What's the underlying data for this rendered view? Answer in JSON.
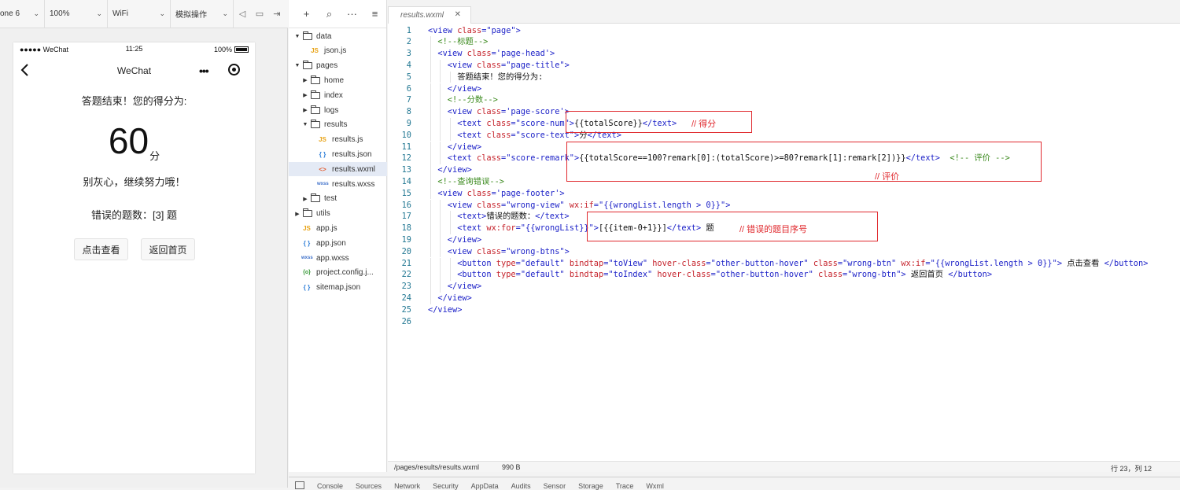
{
  "simulator": {
    "toolbar": {
      "device": "one 6",
      "zoom": "100%",
      "network": "WiFi",
      "mode": "模拟操作"
    },
    "status_bar": {
      "carrier": "●●●●● WeChat",
      "time": "11:25",
      "battery": "100%"
    },
    "nav": {
      "title": "WeChat"
    },
    "page": {
      "title": "答题结束！您的得分为:",
      "score": "60",
      "score_unit": "分",
      "remark": "别灰心，继续努力哦！",
      "wrong_count": "错误的题数：[3] 题",
      "btn_view": "点击查看",
      "btn_home": "返回首页"
    }
  },
  "file_tree": [
    {
      "name": "data",
      "kind": "folder",
      "state": "open",
      "depth": 0
    },
    {
      "name": "json.js",
      "kind": "js",
      "depth": 1
    },
    {
      "name": "pages",
      "kind": "folder",
      "state": "open",
      "depth": 0
    },
    {
      "name": "home",
      "kind": "folder",
      "state": "closed",
      "depth": 1
    },
    {
      "name": "index",
      "kind": "folder",
      "state": "closed",
      "depth": 1
    },
    {
      "name": "logs",
      "kind": "folder",
      "state": "closed",
      "depth": 1
    },
    {
      "name": "results",
      "kind": "folder",
      "state": "open",
      "depth": 1
    },
    {
      "name": "results.js",
      "kind": "js",
      "depth": 2
    },
    {
      "name": "results.json",
      "kind": "json",
      "depth": 2
    },
    {
      "name": "results.wxml",
      "kind": "wxml",
      "depth": 2,
      "selected": true
    },
    {
      "name": "results.wxss",
      "kind": "wxss",
      "depth": 2
    },
    {
      "name": "test",
      "kind": "folder",
      "state": "closed",
      "depth": 1
    },
    {
      "name": "utils",
      "kind": "folder",
      "state": "closed",
      "depth": 0
    },
    {
      "name": "app.js",
      "kind": "js",
      "depth": 0
    },
    {
      "name": "app.json",
      "kind": "json",
      "depth": 0
    },
    {
      "name": "app.wxss",
      "kind": "wxss",
      "depth": 0
    },
    {
      "name": "project.config.j...",
      "kind": "cfg",
      "depth": 0
    },
    {
      "name": "sitemap.json",
      "kind": "json",
      "depth": 0
    }
  ],
  "file_type_glyphs": {
    "js": "JS",
    "json": "{ }",
    "wxml": "<>",
    "wxss": "wxss",
    "cfg": "{o}"
  },
  "editor": {
    "tab": "results.wxml",
    "code": [
      {
        "indent": 0,
        "tokens": [
          [
            "tag",
            "<view "
          ],
          [
            "attr",
            "class"
          ],
          [
            "tag",
            "="
          ],
          [
            "val",
            "\"page\""
          ],
          [
            "tag",
            ">"
          ]
        ]
      },
      {
        "indent": 1,
        "tokens": [
          [
            "cmt",
            "<!--标题-->"
          ]
        ]
      },
      {
        "indent": 1,
        "tokens": [
          [
            "tag",
            "<view "
          ],
          [
            "attr",
            "class"
          ],
          [
            "tag",
            "="
          ],
          [
            "val",
            "'page-head'"
          ],
          [
            "tag",
            ">"
          ]
        ]
      },
      {
        "indent": 2,
        "tokens": [
          [
            "tag",
            "<view "
          ],
          [
            "attr",
            "class"
          ],
          [
            "tag",
            "="
          ],
          [
            "val",
            "\"page-title\""
          ],
          [
            "tag",
            ">"
          ]
        ]
      },
      {
        "indent": 3,
        "tokens": [
          [
            "txt",
            "答题结束！您的得分为:"
          ]
        ]
      },
      {
        "indent": 2,
        "tokens": [
          [
            "tag",
            "</view>"
          ]
        ]
      },
      {
        "indent": 2,
        "tokens": [
          [
            "cmt",
            "<!--分数-->"
          ]
        ]
      },
      {
        "indent": 2,
        "tokens": [
          [
            "tag",
            "<view "
          ],
          [
            "attr",
            "class"
          ],
          [
            "tag",
            "="
          ],
          [
            "val",
            "'page-score'"
          ],
          [
            "tag",
            ">"
          ]
        ]
      },
      {
        "indent": 3,
        "tokens": [
          [
            "tag",
            "<text "
          ],
          [
            "attr",
            "class"
          ],
          [
            "tag",
            "="
          ],
          [
            "val",
            "\"score-num\""
          ],
          [
            "tag",
            ">"
          ],
          [
            "txt",
            "{{totalScore}}"
          ],
          [
            "tag",
            "</text>"
          ]
        ]
      },
      {
        "indent": 3,
        "tokens": [
          [
            "tag",
            "<text "
          ],
          [
            "attr",
            "class"
          ],
          [
            "tag",
            "="
          ],
          [
            "val",
            "\"score-text\""
          ],
          [
            "tag",
            ">"
          ],
          [
            "txt",
            "分"
          ],
          [
            "tag",
            "</text>"
          ]
        ]
      },
      {
        "indent": 2,
        "tokens": [
          [
            "tag",
            "</view>"
          ]
        ]
      },
      {
        "indent": 2,
        "tokens": [
          [
            "tag",
            "<text "
          ],
          [
            "attr",
            "class"
          ],
          [
            "tag",
            "="
          ],
          [
            "val",
            "\"score-remark\""
          ],
          [
            "tag",
            ">"
          ],
          [
            "txt",
            "{{totalScore==100?remark[0]:(totalScore)>=80?remark[1]:remark[2])}}"
          ],
          [
            "tag",
            "</text>"
          ],
          [
            "txt",
            "  "
          ],
          [
            "cmt",
            "<!-- 评价 -->"
          ]
        ]
      },
      {
        "indent": 1,
        "tokens": [
          [
            "tag",
            "</view>"
          ]
        ]
      },
      {
        "indent": 1,
        "tokens": [
          [
            "cmt",
            "<!--查询错误-->"
          ]
        ]
      },
      {
        "indent": 1,
        "tokens": [
          [
            "tag",
            "<view "
          ],
          [
            "attr",
            "class"
          ],
          [
            "tag",
            "="
          ],
          [
            "val",
            "'page-footer'"
          ],
          [
            "tag",
            ">"
          ]
        ]
      },
      {
        "indent": 2,
        "tokens": [
          [
            "tag",
            "<view "
          ],
          [
            "attr",
            "class"
          ],
          [
            "tag",
            "="
          ],
          [
            "val",
            "\"wrong-view\" "
          ],
          [
            "attr",
            "wx:if"
          ],
          [
            "tag",
            "="
          ],
          [
            "val",
            "\"{{wrongList.length > 0}}\""
          ],
          [
            "tag",
            ">"
          ]
        ]
      },
      {
        "indent": 3,
        "tokens": [
          [
            "tag",
            "<text>"
          ],
          [
            "txt",
            "错误的题数："
          ],
          [
            "tag",
            "</text>"
          ]
        ]
      },
      {
        "indent": 3,
        "tokens": [
          [
            "tag",
            "<text "
          ],
          [
            "attr",
            "wx:for"
          ],
          [
            "tag",
            "="
          ],
          [
            "val",
            "\"{{wrongList}}\""
          ],
          [
            "tag",
            ">"
          ],
          [
            "txt",
            "[{{item-0+1}}]"
          ],
          [
            "tag",
            "</text>"
          ],
          [
            "txt",
            " 题"
          ]
        ]
      },
      {
        "indent": 2,
        "tokens": [
          [
            "tag",
            "</view>"
          ]
        ]
      },
      {
        "indent": 2,
        "tokens": [
          [
            "tag",
            "<view "
          ],
          [
            "attr",
            "class"
          ],
          [
            "tag",
            "="
          ],
          [
            "val",
            "\"wrong-btns\""
          ],
          [
            "tag",
            ">"
          ]
        ]
      },
      {
        "indent": 3,
        "tokens": [
          [
            "tag",
            "<button "
          ],
          [
            "attr",
            "type"
          ],
          [
            "tag",
            "="
          ],
          [
            "val",
            "\"default\" "
          ],
          [
            "attr",
            "bindtap"
          ],
          [
            "tag",
            "="
          ],
          [
            "val",
            "\"toView\" "
          ],
          [
            "attr",
            "hover-class"
          ],
          [
            "tag",
            "="
          ],
          [
            "val",
            "\"other-button-hover\" "
          ],
          [
            "attr",
            "class"
          ],
          [
            "tag",
            "="
          ],
          [
            "val",
            "\"wrong-btn\" "
          ],
          [
            "attr",
            "wx:if"
          ],
          [
            "tag",
            "="
          ],
          [
            "val",
            "\"{{wrongList.length > 0}}\""
          ],
          [
            "tag",
            ">"
          ],
          [
            "txt",
            " 点击查看 "
          ],
          [
            "tag",
            "</button>"
          ]
        ]
      },
      {
        "indent": 3,
        "tokens": [
          [
            "tag",
            "<button "
          ],
          [
            "attr",
            "type"
          ],
          [
            "tag",
            "="
          ],
          [
            "val",
            "\"default\" "
          ],
          [
            "attr",
            "bindtap"
          ],
          [
            "tag",
            "="
          ],
          [
            "val",
            "\"toIndex\" "
          ],
          [
            "attr",
            "hover-class"
          ],
          [
            "tag",
            "="
          ],
          [
            "val",
            "\"other-button-hover\" "
          ],
          [
            "attr",
            "class"
          ],
          [
            "tag",
            "="
          ],
          [
            "val",
            "\"wrong-btn\""
          ],
          [
            "tag",
            ">"
          ],
          [
            "txt",
            " 返回首页 "
          ],
          [
            "tag",
            "</button>"
          ]
        ]
      },
      {
        "indent": 2,
        "tokens": [
          [
            "tag",
            "</view>"
          ]
        ]
      },
      {
        "indent": 1,
        "tokens": [
          [
            "tag",
            "</view>"
          ]
        ]
      },
      {
        "indent": 0,
        "tokens": [
          [
            "tag",
            "</view>"
          ]
        ]
      },
      {
        "indent": 0,
        "tokens": []
      }
    ],
    "annotations": {
      "score": "// 得分",
      "remark": "// 评价",
      "wrong": "// 错误的题目序号"
    },
    "status": {
      "path": "/pages/results/results.wxml",
      "size": "990 B",
      "cursor": "行 23，列 12"
    }
  },
  "devtools_tabs": [
    "Console",
    "Sources",
    "Network",
    "Security",
    "AppData",
    "Audits",
    "Sensor",
    "Storage",
    "Trace",
    "Wxml"
  ]
}
